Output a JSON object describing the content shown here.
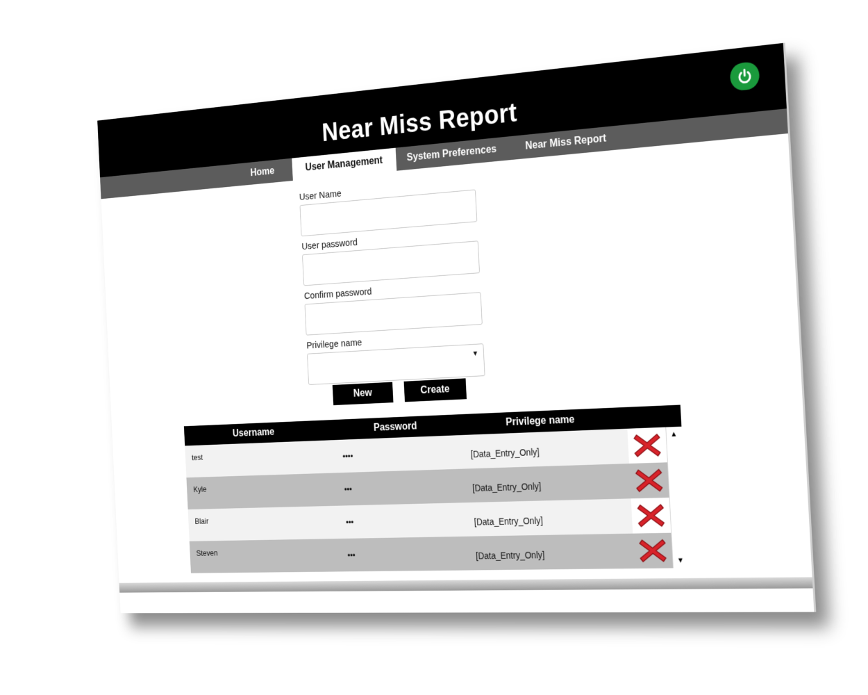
{
  "header": {
    "title": "Near Miss Report",
    "power_icon": "power-icon",
    "power_color": "#1a9a3c"
  },
  "nav": {
    "tabs": [
      {
        "label": "Home",
        "active": false
      },
      {
        "label": "User Management",
        "active": true
      },
      {
        "label": "System Preferences",
        "active": false
      },
      {
        "label": "Near Miss Report",
        "active": false
      }
    ]
  },
  "form": {
    "user_name_label": "User Name",
    "user_name_value": "",
    "user_password_label": "User password",
    "user_password_value": "",
    "confirm_password_label": "Confirm password",
    "confirm_password_value": "",
    "privilege_label": "Privilege name",
    "privilege_value": "",
    "new_button": "New",
    "create_button": "Create"
  },
  "table": {
    "columns": [
      "Username",
      "Password",
      "Privilege name"
    ],
    "rows": [
      {
        "username": "test",
        "password": "••••",
        "privilege": "[Data_Entry_Only]"
      },
      {
        "username": "Kyle",
        "password": "•••",
        "privilege": "[Data_Entry_Only]"
      },
      {
        "username": "Blair",
        "password": "•••",
        "privilege": "[Data_Entry_Only]"
      },
      {
        "username": "Steven",
        "password": "•••",
        "privilege": "[Data_Entry_Only]"
      }
    ],
    "delete_icon": "delete-x-icon",
    "delete_color": "#d8232a"
  }
}
